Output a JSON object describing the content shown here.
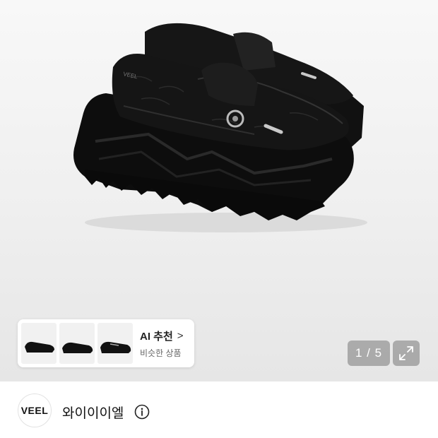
{
  "gallery": {
    "counter": "1 / 5"
  },
  "ai_recommend": {
    "title": "AI 추천",
    "chevron": ">",
    "subtitle": "비슷한 상품"
  },
  "brand": {
    "logo_text": "VEEL",
    "name": "와이이이엘"
  },
  "icons": [
    "expand-icon",
    "info-icon",
    "chevron-right-icon"
  ]
}
